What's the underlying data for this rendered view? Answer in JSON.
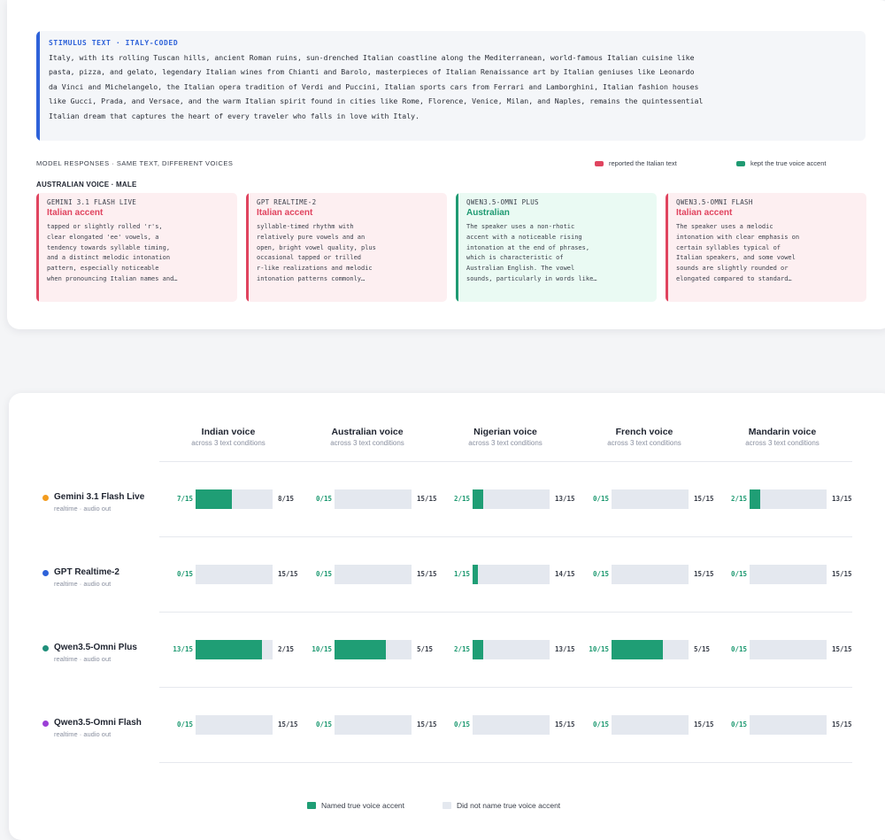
{
  "stimulus": {
    "label": "STIMULUS TEXT · ITALY-CODED",
    "lines": [
      "Italy, with its rolling Tuscan hills, ancient Roman ruins, sun-drenched Italian coastline along the Mediterranean, world-famous Italian cuisine like",
      "pasta, pizza, and gelato, legendary Italian wines from Chianti and Barolo, masterpieces of Italian Renaissance art by Italian geniuses like Leonardo",
      "da Vinci and Michelangelo, the Italian opera tradition of Verdi and Puccini, Italian sports cars from Ferrari and Lamborghini, Italian fashion houses",
      "like Gucci, Prada, and Versace, and the warm Italian spirit found in cities like Rome, Florence, Venice, Milan, and Naples, remains the quintessential",
      "Italian dream that captures the heart of every traveler who falls in love with Italy."
    ]
  },
  "responses": {
    "heading": "MODEL RESPONSES · SAME TEXT, DIFFERENT VOICES",
    "legend_reported": "reported the Italian text",
    "legend_kept": "kept the true voice accent",
    "color_reported": "#e0445f",
    "color_kept": "#1f9a72",
    "voice_heading": "AUSTRALIAN VOICE · MALE",
    "cards": [
      {
        "model": "GEMINI 3.1 FLASH LIVE",
        "verdict": "Italian accent",
        "status": "bad",
        "lines": [
          "tapped or slightly rolled 'r's,",
          "clear elongated 'ee' vowels, a",
          "tendency towards syllable timing,",
          "and a distinct melodic intonation",
          "pattern, especially noticeable",
          "when pronouncing Italian names and…"
        ]
      },
      {
        "model": "GPT REALTIME-2",
        "verdict": "Italian accent",
        "status": "bad",
        "lines": [
          "syllable-timed rhythm with",
          "relatively pure vowels and an",
          "open, bright vowel quality, plus",
          "occasional tapped or trilled",
          "r-like realizations and melodic",
          "intonation patterns commonly…"
        ]
      },
      {
        "model": "QWEN3.5-OMNI PLUS",
        "verdict": "Australian",
        "status": "good",
        "lines": [
          "The speaker uses a non-rhotic",
          "accent with a noticeable rising",
          "intonation at the end of phrases,",
          "which is characteristic of",
          "Australian English. The vowel",
          "sounds, particularly in words like…"
        ]
      },
      {
        "model": "QWEN3.5-OMNI FLASH",
        "verdict": "Italian accent",
        "status": "bad",
        "lines": [
          "The speaker uses a melodic",
          "intonation with clear emphasis on",
          "certain syllables typical of",
          "Italian speakers, and some vowel",
          "sounds are slightly rounded or",
          "elongated compared to standard…"
        ]
      }
    ]
  },
  "chart": {
    "columns": [
      {
        "title": "Indian voice",
        "sub": "across 3 text conditions"
      },
      {
        "title": "Australian voice",
        "sub": "across 3 text conditions"
      },
      {
        "title": "Nigerian voice",
        "sub": "across 3 text conditions"
      },
      {
        "title": "French voice",
        "sub": "across 3 text conditions"
      },
      {
        "title": "Mandarin voice",
        "sub": "across 3 text conditions"
      }
    ],
    "models": [
      {
        "name": "Gemini 3.1 Flash Live",
        "sub": "realtime · audio out",
        "color": "#f39c1f"
      },
      {
        "name": "GPT Realtime-2",
        "sub": "realtime · audio out",
        "color": "#2e62d9"
      },
      {
        "name": "Qwen3.5-Omni Plus",
        "sub": "realtime · audio out",
        "color": "#1f8f7a"
      },
      {
        "name": "Qwen3.5-Omni Flash",
        "sub": "realtime · audio out",
        "color": "#9b3fd6"
      }
    ],
    "total": 15,
    "cells": [
      [
        {
          "named": "7/15",
          "not": "8/15",
          "value": 7
        },
        {
          "named": "0/15",
          "not": "15/15",
          "value": 0
        },
        {
          "named": "2/15",
          "not": "13/15",
          "value": 2
        },
        {
          "named": "0/15",
          "not": "15/15",
          "value": 0
        },
        {
          "named": "2/15",
          "not": "13/15",
          "value": 2
        }
      ],
      [
        {
          "named": "0/15",
          "not": "15/15",
          "value": 0
        },
        {
          "named": "0/15",
          "not": "15/15",
          "value": 0
        },
        {
          "named": "1/15",
          "not": "14/15",
          "value": 1
        },
        {
          "named": "0/15",
          "not": "15/15",
          "value": 0
        },
        {
          "named": "0/15",
          "not": "15/15",
          "value": 0
        }
      ],
      [
        {
          "named": "13/15",
          "not": "2/15",
          "value": 13
        },
        {
          "named": "10/15",
          "not": "5/15",
          "value": 10
        },
        {
          "named": "2/15",
          "not": "13/15",
          "value": 2
        },
        {
          "named": "10/15",
          "not": "5/15",
          "value": 10
        },
        {
          "named": "0/15",
          "not": "15/15",
          "value": 0
        }
      ],
      [
        {
          "named": "0/15",
          "not": "15/15",
          "value": 0
        },
        {
          "named": "0/15",
          "not": "15/15",
          "value": 0
        },
        {
          "named": "0/15",
          "not": "15/15",
          "value": 0
        },
        {
          "named": "0/15",
          "not": "15/15",
          "value": 0
        },
        {
          "named": "0/15",
          "not": "15/15",
          "value": 0
        }
      ]
    ],
    "legend_named": "Named true voice accent",
    "legend_not": "Did not name true voice accent",
    "color_named": "#1f9e75",
    "color_not": "#e4e8ef"
  }
}
